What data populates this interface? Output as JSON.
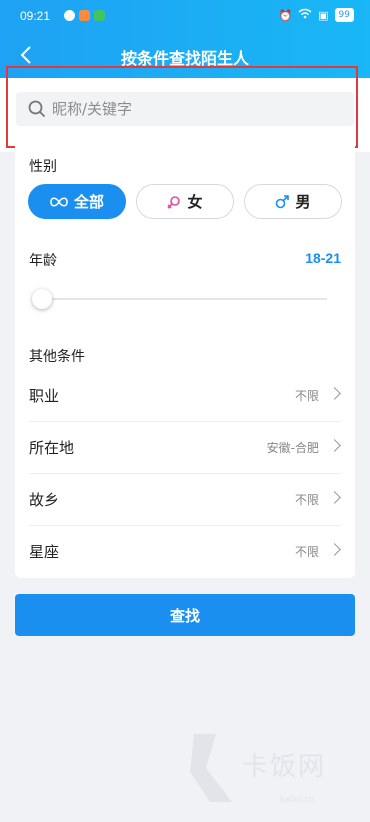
{
  "status_bar": {
    "time": "09:21",
    "battery": "99",
    "app_icons": [
      "wechat-icon",
      "orange-app-icon",
      "green-app-icon"
    ],
    "app_icon_colors": [
      "#ffffff",
      "#ff8a3d",
      "#43c463"
    ]
  },
  "nav": {
    "title": "按条件查找陌生人",
    "back_icon": "back-arrow-icon"
  },
  "search": {
    "placeholder": "昵称/关键字",
    "value": ""
  },
  "filters": {
    "gender": {
      "label": "性别",
      "options": [
        {
          "label": "全部",
          "icon": "infinity-icon",
          "selected": true
        },
        {
          "label": "女",
          "icon": "female-icon",
          "selected": false
        },
        {
          "label": "男",
          "icon": "male-icon",
          "selected": false
        }
      ]
    },
    "age": {
      "label": "年龄",
      "value": "18-21",
      "slider_min_fraction": 0.0
    },
    "other": {
      "label": "其他条件",
      "rows": [
        {
          "label": "职业",
          "value": "不限"
        },
        {
          "label": "所在地",
          "value": "安徽-合肥"
        },
        {
          "label": "故乡",
          "value": "不限"
        },
        {
          "label": "星座",
          "value": "不限"
        }
      ]
    }
  },
  "submit_label": "查找",
  "watermark": {
    "text": "卡饭网",
    "sub": "kafan.cn"
  },
  "colors": {
    "accent": "#1a8ff0",
    "header": "#1ea2f3",
    "highlight": "#e0393e",
    "female": "#e64aa8",
    "male": "#1a8ff0"
  }
}
